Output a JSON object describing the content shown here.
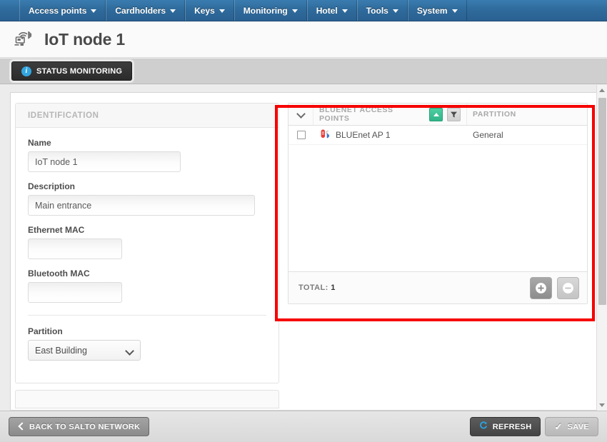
{
  "navbar": {
    "items": [
      {
        "label": "Access points",
        "icon": "chevron-down-icon"
      },
      {
        "label": "Cardholders",
        "icon": "chevron-down-icon"
      },
      {
        "label": "Keys",
        "icon": "chevron-down-icon"
      },
      {
        "label": "Monitoring",
        "icon": "chevron-down-icon"
      },
      {
        "label": "Hotel",
        "icon": "chevron-down-icon"
      },
      {
        "label": "Tools",
        "icon": "chevron-down-icon"
      },
      {
        "label": "System",
        "icon": "chevron-down-icon"
      }
    ]
  },
  "header": {
    "title": "IoT node 1",
    "icon": "iot-node-bluetooth-icon"
  },
  "tabs": [
    {
      "label": "STATUS MONITORING",
      "icon": "info-icon",
      "active": true
    }
  ],
  "identification": {
    "section_title": "IDENTIFICATION",
    "fields": [
      {
        "label": "Name",
        "value": "IoT node 1",
        "placeholder": ""
      },
      {
        "label": "Description",
        "value": "Main entrance",
        "placeholder": ""
      },
      {
        "label": "Ethernet MAC",
        "value": "",
        "placeholder": ""
      },
      {
        "label": "Bluetooth MAC",
        "value": "",
        "placeholder": ""
      }
    ],
    "partition": {
      "label": "Partition",
      "value": "East Building",
      "icon": "chevron-down-icon"
    }
  },
  "grid": {
    "columns": [
      {
        "key": "select",
        "label": "",
        "icon": "chevron-down-icon"
      },
      {
        "key": "name",
        "label": "BLUENET ACCESS POINTS",
        "sort_icon": "sort-ascending-icon",
        "filter_icon": "filter-icon"
      },
      {
        "key": "partition",
        "label": "PARTITION"
      }
    ],
    "rows": [
      {
        "checked": false,
        "icon": "bluenet-ap-bluetooth-icon",
        "name": "BLUEnet AP 1",
        "partition": "General"
      }
    ],
    "footer": {
      "total_label": "TOTAL:",
      "total_value": "1",
      "add_icon": "plus-circle-icon",
      "remove_icon": "minus-circle-icon"
    }
  },
  "bottombar": {
    "back": {
      "label": "BACK TO SALTO NETWORK",
      "icon": "chevron-left-icon"
    },
    "refresh": {
      "label": "REFRESH",
      "icon": "refresh-icon"
    },
    "save": {
      "label": "SAVE",
      "icon": "check-icon"
    }
  },
  "scrollbar": {
    "up_icon": "triangle-up-icon",
    "down_icon": "triangle-down-icon"
  },
  "colors": {
    "nav_blue": "#2f6b9c",
    "accent_green": "#31b489",
    "info_blue": "#33a6e0",
    "highlight_red": "#f60000",
    "refresh_blue": "#2aa3e0"
  }
}
